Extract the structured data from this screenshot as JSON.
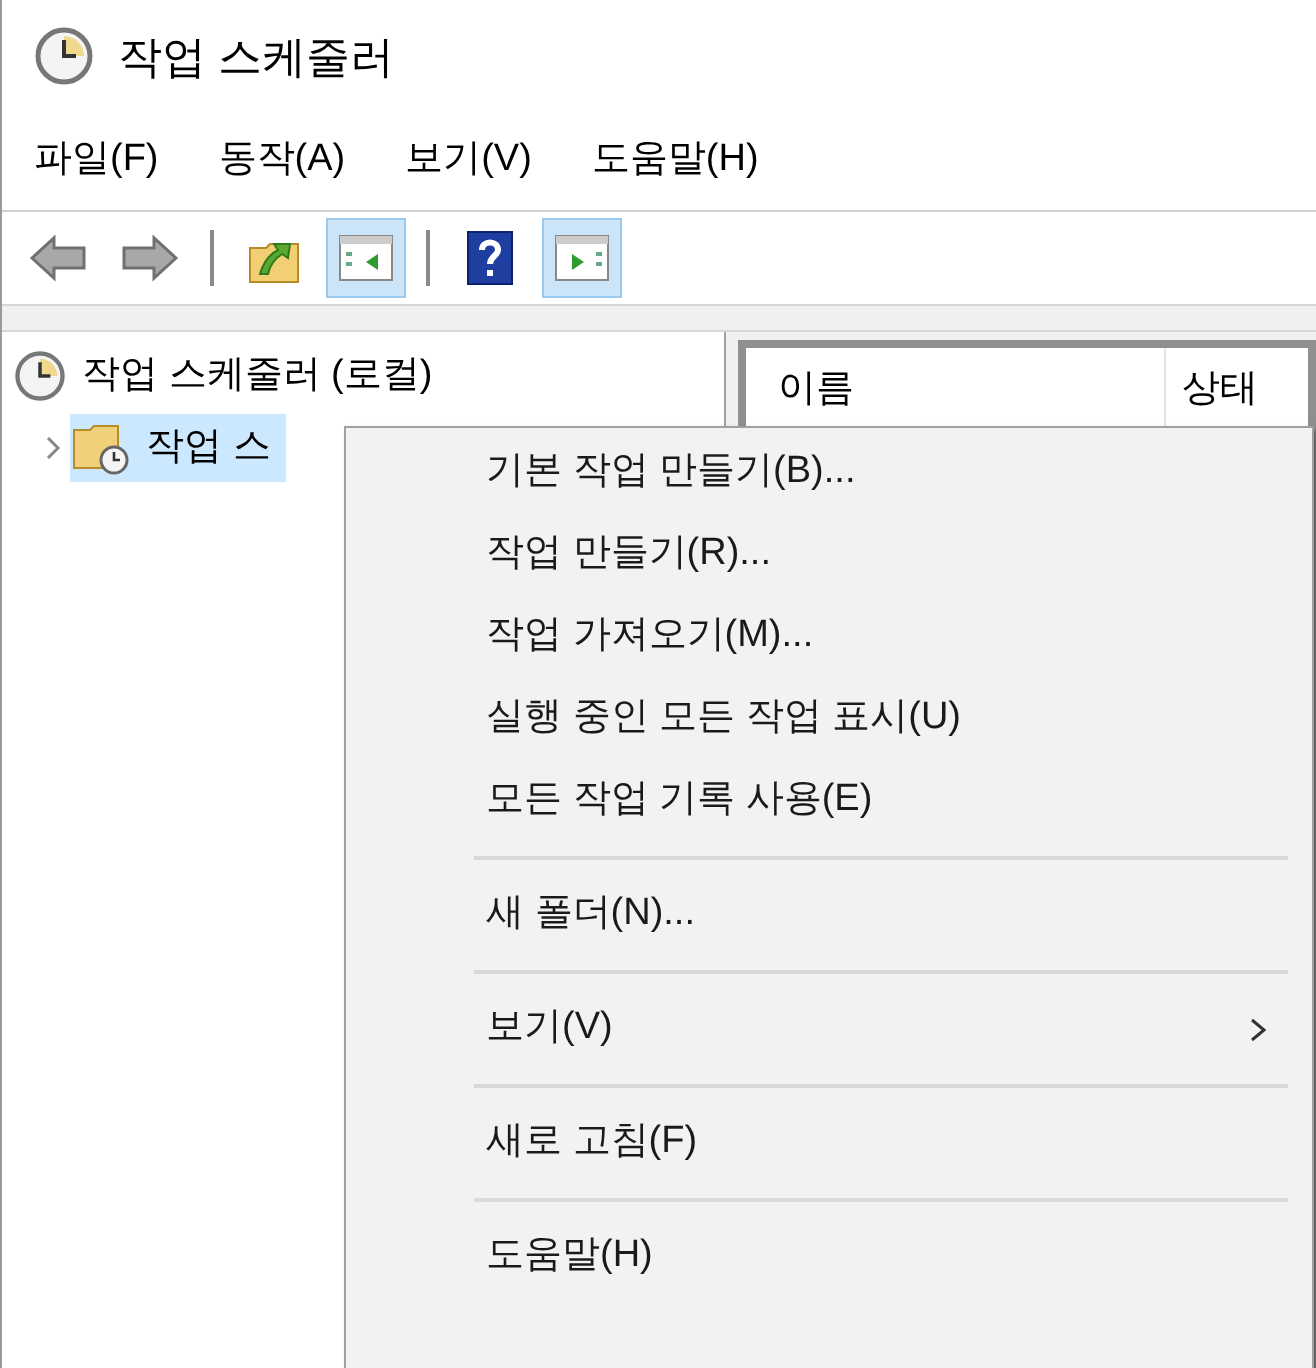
{
  "window": {
    "title": "작업 스케줄러"
  },
  "menu_bar": [
    {
      "label": "파일(F)"
    },
    {
      "label": "동작(A)"
    },
    {
      "label": "보기(V)"
    },
    {
      "label": "도움말(H)"
    }
  ],
  "toolbar": [
    {
      "kind": "back",
      "pressed": false
    },
    {
      "kind": "forward",
      "pressed": false
    },
    {
      "kind": "separator"
    },
    {
      "kind": "up",
      "pressed": false
    },
    {
      "kind": "tree",
      "pressed": true
    },
    {
      "kind": "separator"
    },
    {
      "kind": "help",
      "pressed": false
    },
    {
      "kind": "actions",
      "pressed": true
    }
  ],
  "tree": [
    {
      "label": "작업 스케줄러 (로컬)",
      "selected": false,
      "children": [
        {
          "label": "작업 스",
          "selected": true,
          "expanded": false
        }
      ]
    }
  ],
  "list": {
    "columns": [
      "이름",
      "상태"
    ]
  },
  "context_menu": [
    {
      "kind": "item",
      "label": "기본 작업 만들기(B)..."
    },
    {
      "kind": "item",
      "label": "작업 만들기(R)..."
    },
    {
      "kind": "item",
      "label": "작업 가져오기(M)..."
    },
    {
      "kind": "item",
      "label": "실행 중인 모든 작업 표시(U)"
    },
    {
      "kind": "item",
      "label": "모든 작업 기록 사용(E)"
    },
    {
      "kind": "separator"
    },
    {
      "kind": "item",
      "label": "새 폴더(N)..."
    },
    {
      "kind": "separator"
    },
    {
      "kind": "item",
      "label": "보기(V)",
      "submenu": true
    },
    {
      "kind": "separator"
    },
    {
      "kind": "item",
      "label": "새로 고침(F)"
    },
    {
      "kind": "separator"
    },
    {
      "kind": "item",
      "label": "도움말(H)"
    }
  ]
}
